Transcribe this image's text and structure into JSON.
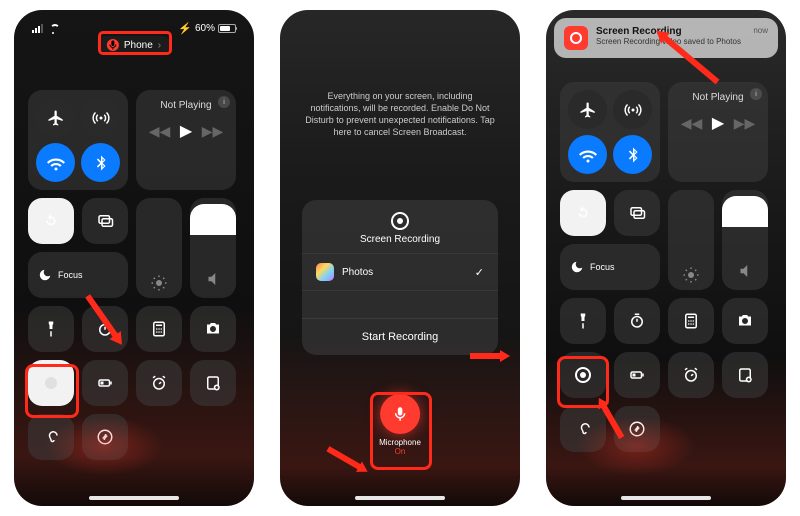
{
  "status": {
    "battery_pct": "60%",
    "charge_icon": "⚡"
  },
  "pill": {
    "label": "Phone",
    "chevron": "›"
  },
  "nowplaying": {
    "label": "Not Playing",
    "prev": "◀◀",
    "play": "▶",
    "next": "▶▶",
    "info": "i"
  },
  "focus": {
    "label": "Focus"
  },
  "mid": {
    "warning": "Everything on your screen, including notifications, will be recorded. Enable Do Not Disturb to prevent unexpected notifications. Tap here to cancel Screen Broadcast.",
    "sheet_title": "Screen Recording",
    "destination": "Photos",
    "start": "Start Recording"
  },
  "mic": {
    "label": "Microphone",
    "state": "On"
  },
  "notif": {
    "title": "Screen Recording",
    "subtitle": "Screen Recording video saved to Photos",
    "time": "now"
  }
}
